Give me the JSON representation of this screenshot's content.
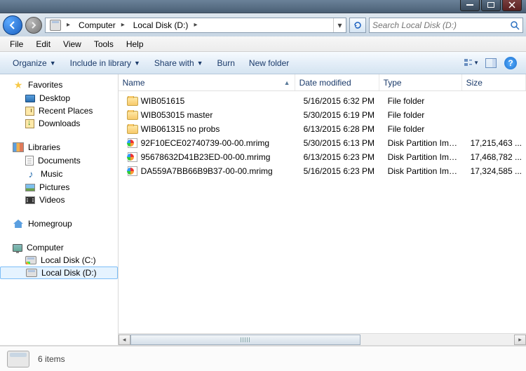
{
  "window": {
    "minimize": "–",
    "maximize": "□",
    "close": "×"
  },
  "address": {
    "segments": [
      "Computer",
      "Local Disk (D:)"
    ]
  },
  "search": {
    "placeholder": "Search Local Disk (D:)"
  },
  "menu": {
    "file": "File",
    "edit": "Edit",
    "view": "View",
    "tools": "Tools",
    "help": "Help"
  },
  "toolbar": {
    "organize": "Organize",
    "include": "Include in library",
    "share": "Share with",
    "burn": "Burn",
    "newfolder": "New folder"
  },
  "sidebar": {
    "favorites": {
      "label": "Favorites",
      "items": [
        {
          "label": "Desktop"
        },
        {
          "label": "Recent Places"
        },
        {
          "label": "Downloads"
        }
      ]
    },
    "libraries": {
      "label": "Libraries",
      "items": [
        {
          "label": "Documents"
        },
        {
          "label": "Music"
        },
        {
          "label": "Pictures"
        },
        {
          "label": "Videos"
        }
      ]
    },
    "homegroup": {
      "label": "Homegroup"
    },
    "computer": {
      "label": "Computer",
      "items": [
        {
          "label": "Local Disk (C:)"
        },
        {
          "label": "Local Disk (D:)"
        }
      ]
    }
  },
  "columns": {
    "name": "Name",
    "date": "Date modified",
    "type": "Type",
    "size": "Size"
  },
  "files": [
    {
      "name": "WIB051615",
      "date": "5/16/2015 6:32 PM",
      "type": "File folder",
      "size": "",
      "kind": "folder"
    },
    {
      "name": "WIB053015 master",
      "date": "5/30/2015 6:19 PM",
      "type": "File folder",
      "size": "",
      "kind": "folder"
    },
    {
      "name": "WIB061315 no probs",
      "date": "6/13/2015 6:28 PM",
      "type": "File folder",
      "size": "",
      "kind": "folder"
    },
    {
      "name": "92F10ECE02740739-00-00.mrimg",
      "date": "5/30/2015 6:13 PM",
      "type": "Disk Partition Image",
      "size": "17,215,463 ...",
      "kind": "mrimg"
    },
    {
      "name": "95678632D41B23ED-00-00.mrimg",
      "date": "6/13/2015 6:23 PM",
      "type": "Disk Partition Image",
      "size": "17,468,782 ...",
      "kind": "mrimg"
    },
    {
      "name": "DA559A7BB66B9B37-00-00.mrimg",
      "date": "5/16/2015 6:23 PM",
      "type": "Disk Partition Image",
      "size": "17,324,585 ...",
      "kind": "mrimg"
    }
  ],
  "status": {
    "count": "6 items"
  }
}
